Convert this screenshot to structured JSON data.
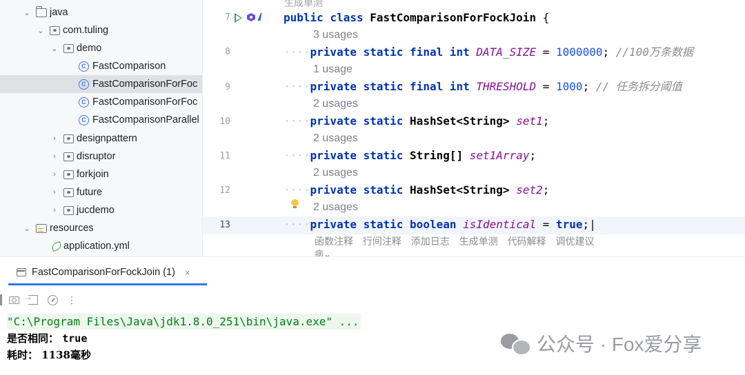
{
  "tree": {
    "items": [
      {
        "label": "java",
        "kind": "folder",
        "expanded": true
      },
      {
        "label": "com.tuling",
        "kind": "package",
        "expanded": true
      },
      {
        "label": "demo",
        "kind": "package",
        "expanded": true
      },
      {
        "label": "FastComparison",
        "kind": "class"
      },
      {
        "label": "FastComparisonForFoc",
        "kind": "class",
        "selected": true
      },
      {
        "label": "FastComparisonForFoc",
        "kind": "class"
      },
      {
        "label": "FastComparisonParallel",
        "kind": "class"
      },
      {
        "label": "designpattern",
        "kind": "package",
        "expanded": false
      },
      {
        "label": "disruptor",
        "kind": "package",
        "expanded": false
      },
      {
        "label": "forkjoin",
        "kind": "package",
        "expanded": false
      },
      {
        "label": "future",
        "kind": "package",
        "expanded": false
      },
      {
        "label": "jucdemo",
        "kind": "package",
        "expanded": false
      },
      {
        "label": "resources",
        "kind": "resources",
        "expanded": true
      },
      {
        "label": "application.yml",
        "kind": "yml"
      }
    ]
  },
  "editor": {
    "top_hint": "生成单测",
    "class_line": {
      "number": "7",
      "kw1": "public",
      "kw2": "class",
      "name": "FastComparisonForFockJoin",
      "brace": "{"
    },
    "lines": [
      {
        "usage": "3 usages",
        "number": "8",
        "kw": [
          "private",
          "static",
          "final",
          "int"
        ],
        "field": "DATA_SIZE",
        "op": "=",
        "value": "1000000",
        "end": ";",
        "comment": "//100万条数据"
      },
      {
        "usage": "1 usage",
        "number": "9",
        "kw": [
          "private",
          "static",
          "final",
          "int"
        ],
        "field": "THRESHOLD",
        "op": "=",
        "value": "1000",
        "end": ";",
        "comment": "// 任务拆分阈值"
      },
      {
        "usage": "2 usages",
        "number": "10",
        "kw": [
          "private",
          "static"
        ],
        "type": "HashSet<String>",
        "field": "set1",
        "end": ";"
      },
      {
        "usage": "2 usages",
        "number": "11",
        "kw": [
          "private",
          "static"
        ],
        "type": "String[]",
        "field": "set1Array",
        "end": ";"
      },
      {
        "usage": "2 usages",
        "number": "12",
        "kw": [
          "private",
          "static"
        ],
        "type": "HashSet<String>",
        "field": "set2",
        "end": ";"
      },
      {
        "usage": "2 usages",
        "number": "13",
        "kw": [
          "private",
          "static",
          "boolean"
        ],
        "field": "isIdentical",
        "op": "=",
        "value": "true",
        "end": ";"
      }
    ],
    "actions": [
      "函数注释",
      "行间注释",
      "添加日志",
      "生成单测",
      "代码解释",
      "调优建议"
    ],
    "actions_more": "病"
  },
  "run": {
    "tab_label": "FastComparisonForFockJoin (1)",
    "tab_close": "×",
    "toolbar_more": "⋮",
    "console": {
      "command": "\"C:\\Program Files\\Java\\jdk1.8.0_251\\bin\\java.exe\" ...",
      "result_label": "是否相同：",
      "result_value": "true",
      "time_label": "耗时：",
      "time_value": "1138毫秒"
    }
  },
  "watermark": {
    "text": "公众号 · Fox爱分享"
  },
  "colors": {
    "keyword": "#0033b3",
    "field": "#871094",
    "number": "#1750eb",
    "comment": "#8c8c8c",
    "console_cmd": "#067d17",
    "accent": "#3574f0"
  }
}
